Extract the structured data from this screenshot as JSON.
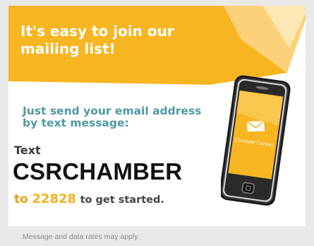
{
  "headline": "It's easy to join our mailing list!",
  "subhead": "Just send your email address by text message:",
  "text_label": "Text",
  "keyword": "CSRCHAMBER",
  "cta": {
    "to": "to",
    "number": "22828",
    "rest": "to get started."
  },
  "phone_screen": {
    "brand": "Constant Contact"
  },
  "footer": "Message and data rates may apply.",
  "colors": {
    "accent_yellow": "#f7b521",
    "teal": "#4e9aa0",
    "background": "#e9e9e9"
  },
  "icons": [
    "smartphone-icon",
    "envelope-logo-icon"
  ]
}
